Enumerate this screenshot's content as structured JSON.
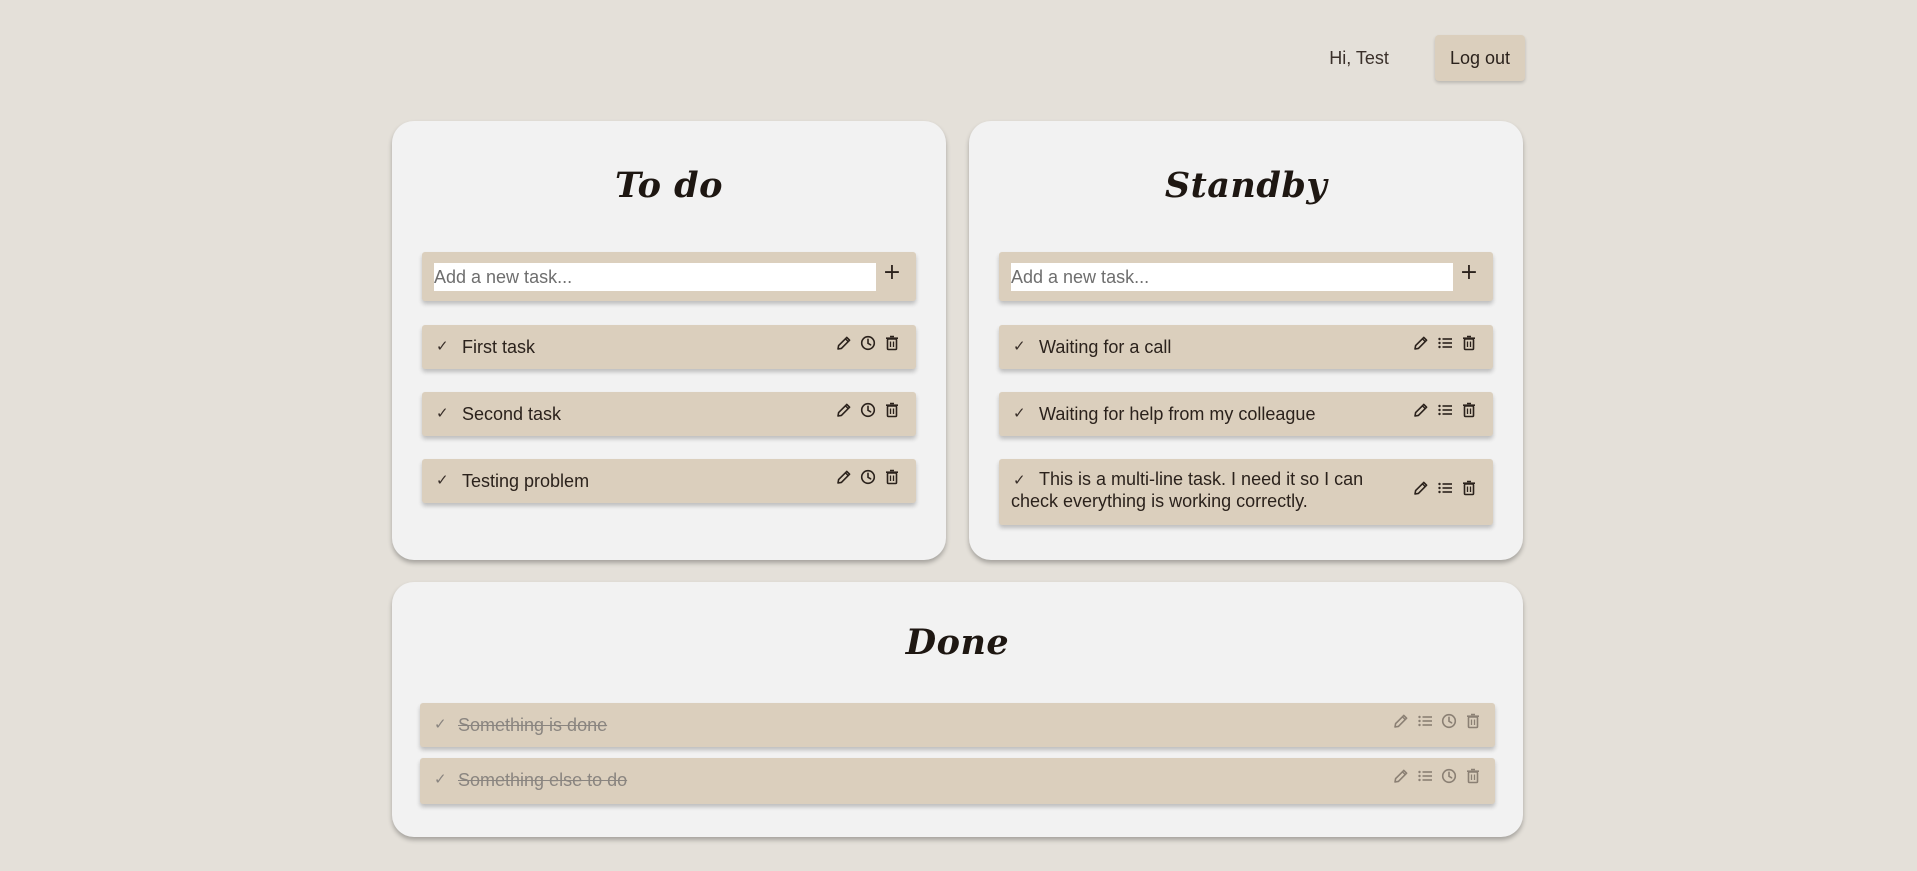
{
  "header": {
    "greeting": "Hi, Test",
    "logout_label": "Log out"
  },
  "columns": {
    "todo": {
      "title": "To do",
      "placeholder": "Add a new task...",
      "add_label": "+",
      "tasks": [
        "First task",
        "Second task",
        "Testing problem"
      ]
    },
    "standby": {
      "title": "Standby",
      "placeholder": "Add a new task...",
      "add_label": "+",
      "tasks": [
        "Waiting for a call",
        "Waiting for help from my colleague",
        "This is a multi-line task. I need it so I can check everything is working correctly."
      ]
    },
    "done": {
      "title": "Done",
      "tasks": [
        "Something is done",
        "Something else to do"
      ]
    }
  },
  "icons": {
    "check": "check-icon",
    "edit": "pencil-icon",
    "clock": "clock-icon",
    "list": "list-icon",
    "delete": "trash-icon"
  },
  "colors": {
    "background": "#e4e0d9",
    "panel": "#f2f2f2",
    "task": "#dbcfbd",
    "text": "#2b221c",
    "done_text": "#8a8580"
  }
}
